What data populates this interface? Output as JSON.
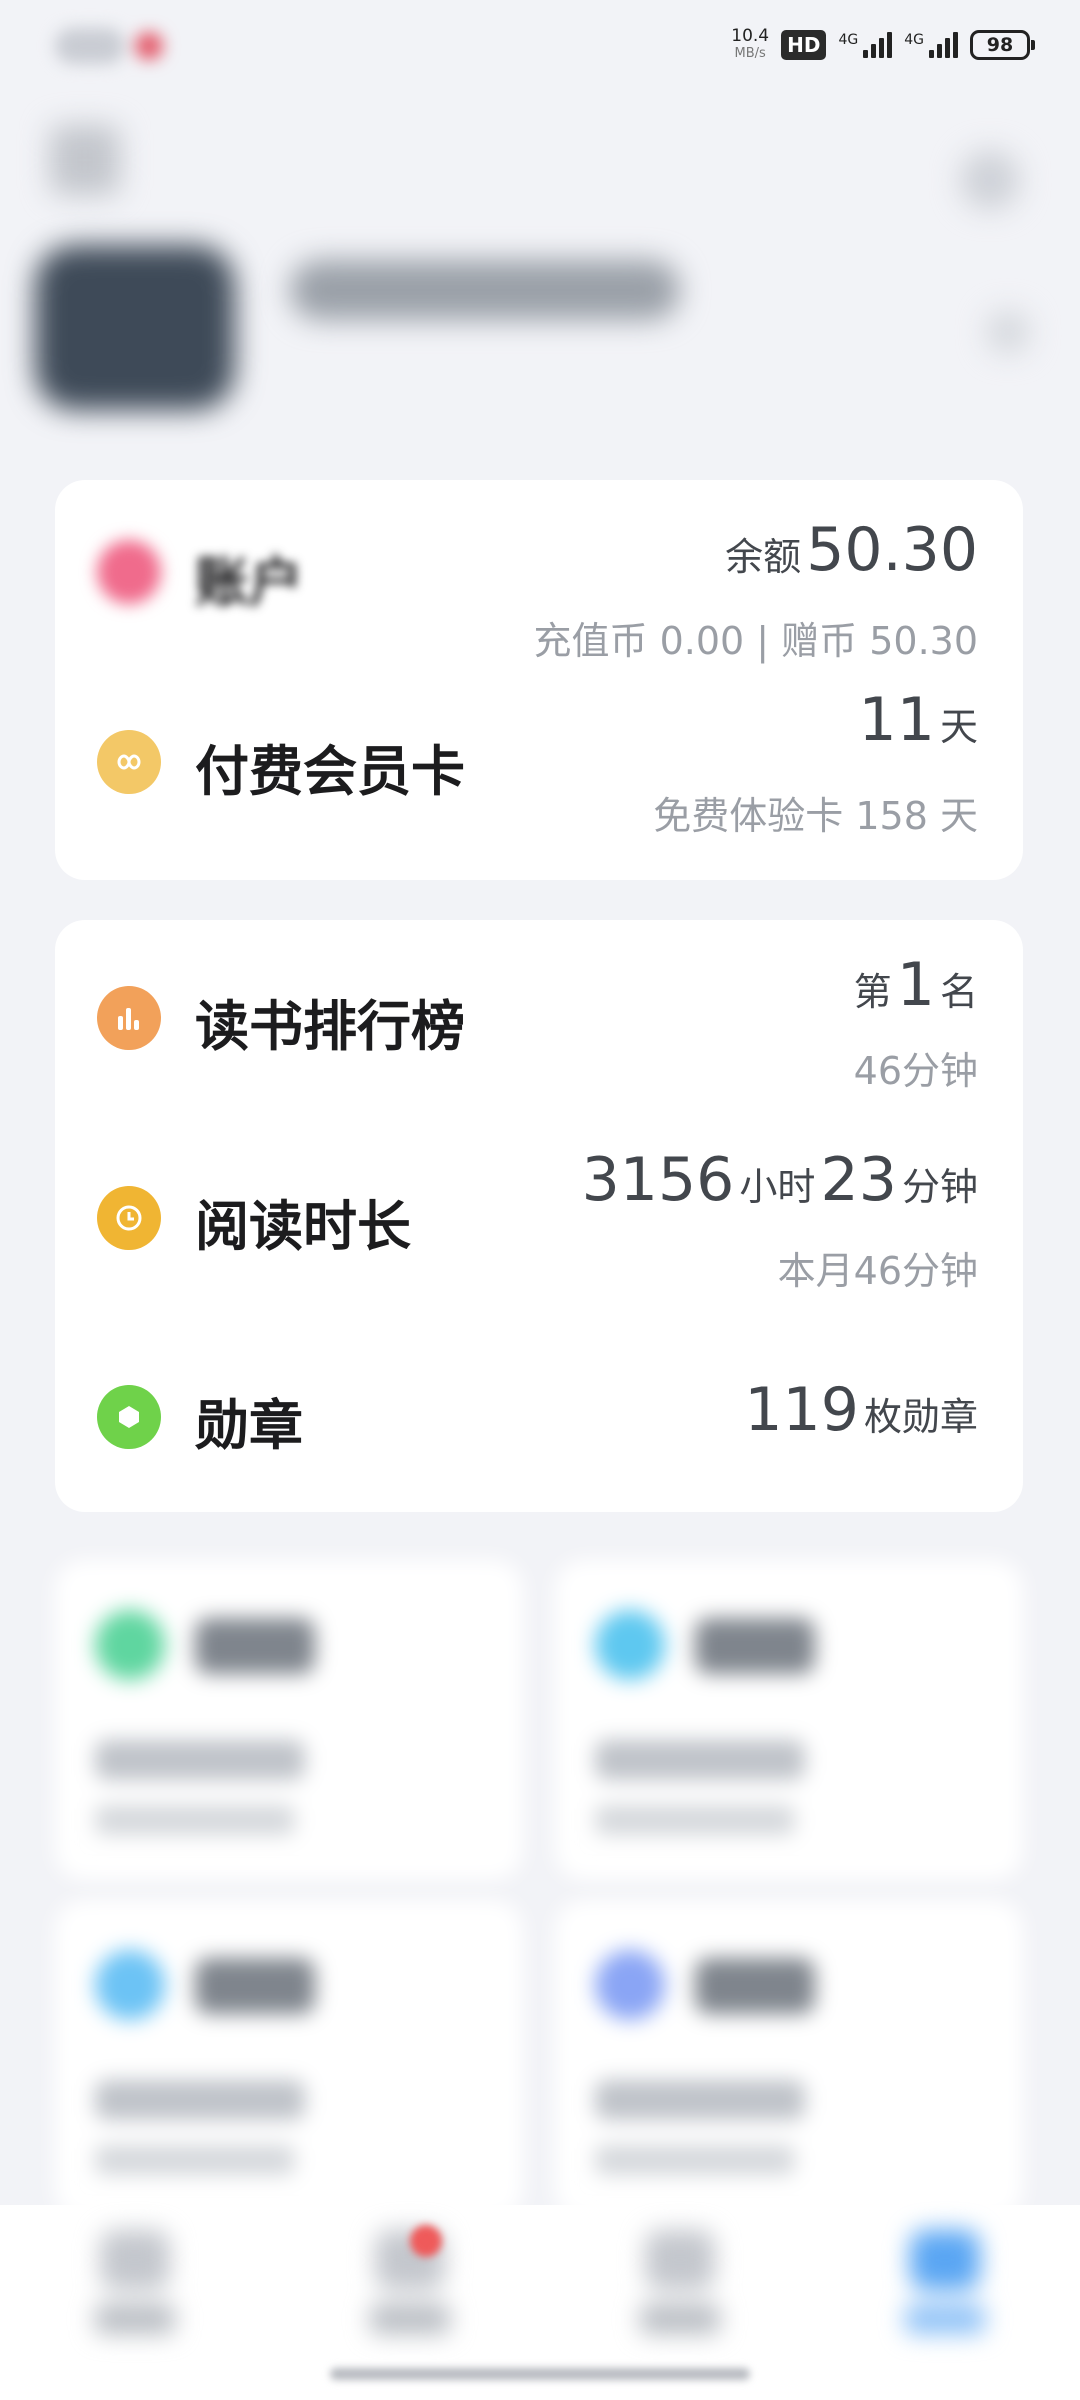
{
  "status_bar": {
    "net_speed": "10.4",
    "net_unit": "MB/s",
    "hd_label": "HD",
    "sim1_label": "4G",
    "sim2_label": "4G",
    "battery": "98"
  },
  "account_card": {
    "title": "账户",
    "balance_label": "余额",
    "balance_value": "50.30",
    "detail": "充值币 0.00 | 赠币 50.30",
    "membership_title": "付费会员卡",
    "membership_days": "11",
    "membership_unit": "天",
    "trial_text": "免费体验卡 158 天"
  },
  "reading_card": {
    "ranking_title": "读书排行榜",
    "rank_prefix": "第",
    "rank_value": "1",
    "rank_suffix": "名",
    "rank_minutes": "46分钟",
    "duration_title": "阅读时长",
    "duration_hours": "3156",
    "hours_unit": "小时",
    "duration_minutes": "23",
    "minutes_unit": "分钟",
    "duration_month": "本月46分钟",
    "badge_title": "勋章",
    "badge_count": "119",
    "badge_unit": "枚勋章"
  },
  "colors": {
    "account_icon": "#f06b8c",
    "membership_icon": "#f3c867",
    "ranking_icon": "#f2a15a",
    "duration_icon": "#f0b533",
    "badge_icon": "#6fd24a",
    "tile1_icon": "#5fd6a0",
    "tile2_icon": "#5ec8f0",
    "tile3_icon": "#6cc3f5",
    "tile4_icon": "#8aa5f5",
    "tab_active": "#5aa6f3"
  }
}
